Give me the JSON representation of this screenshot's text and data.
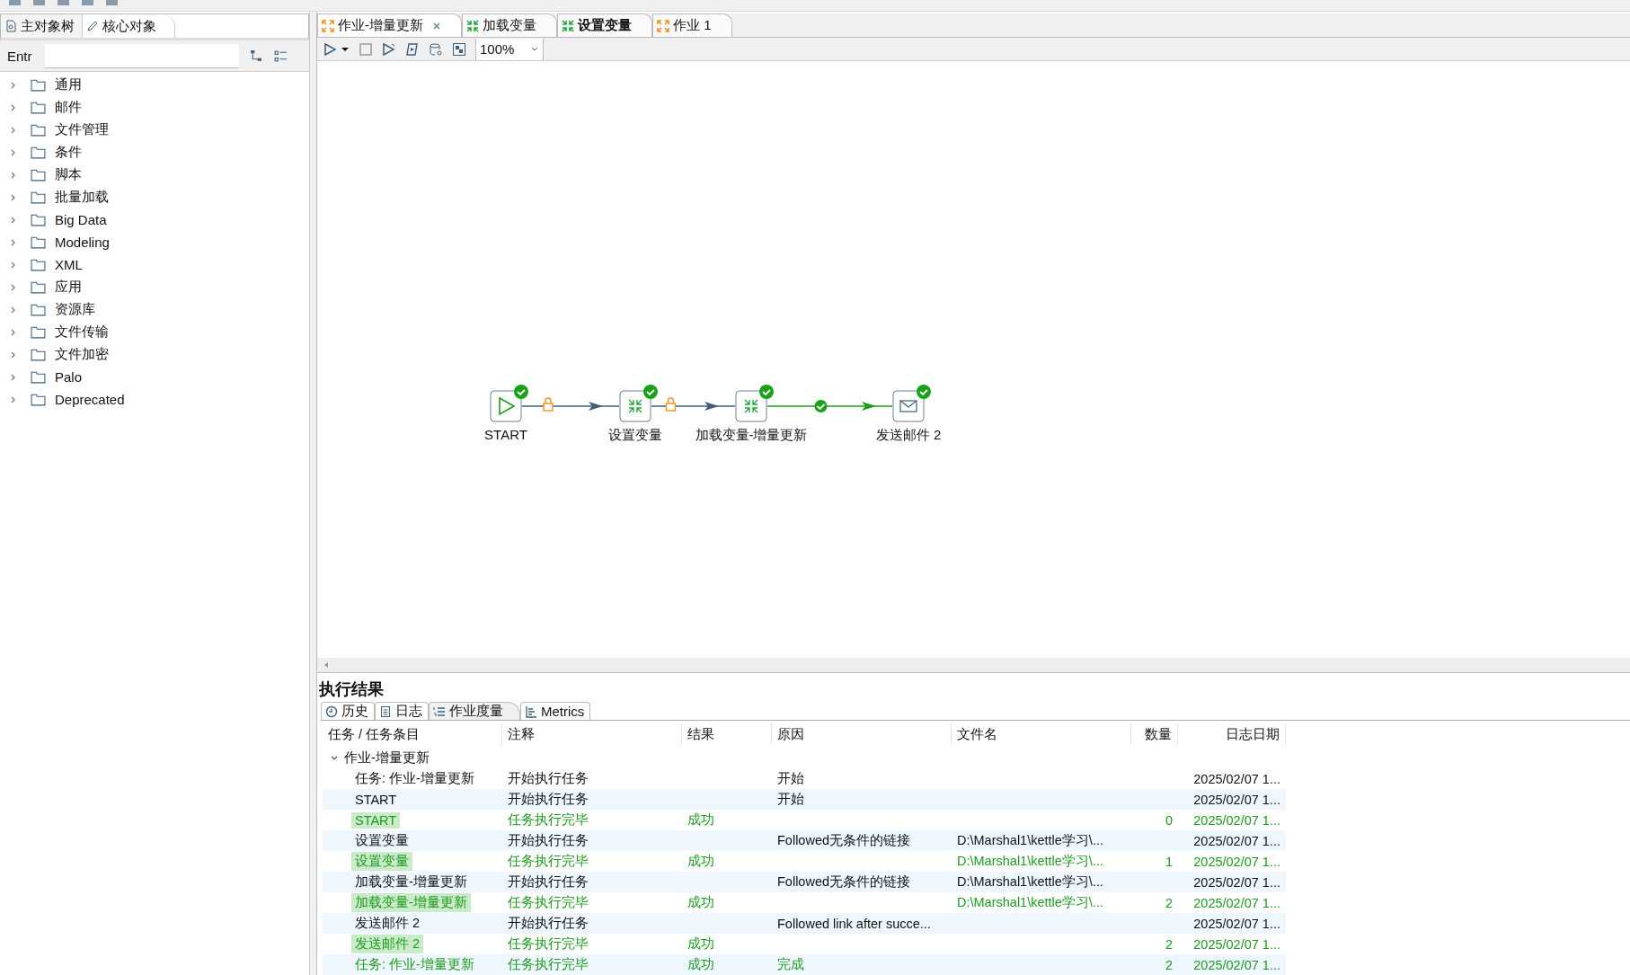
{
  "left_panel": {
    "tabs": [
      {
        "label": "主对象树",
        "kind": "tree",
        "selected": false
      },
      {
        "label": "核心对象",
        "kind": "pencil",
        "selected": true
      }
    ],
    "filter": {
      "label": "Entr"
    },
    "tree": [
      {
        "label": "通用",
        "expanded": false
      },
      {
        "label": "邮件",
        "expanded": false
      },
      {
        "label": "文件管理",
        "expanded": false
      },
      {
        "label": "条件",
        "expanded": false
      },
      {
        "label": "脚本",
        "expanded": false
      },
      {
        "label": "批量加载",
        "expanded": false
      },
      {
        "label": "Big Data",
        "expanded": false
      },
      {
        "label": "Modeling",
        "expanded": false
      },
      {
        "label": "XML",
        "expanded": false
      },
      {
        "label": "应用",
        "expanded": false
      },
      {
        "label": "资源库",
        "expanded": false
      },
      {
        "label": "文件传输",
        "expanded": false
      },
      {
        "label": "文件加密",
        "expanded": false
      },
      {
        "label": "Palo",
        "expanded": false
      },
      {
        "label": "Deprecated",
        "expanded": false
      }
    ]
  },
  "editor": {
    "tabs": [
      {
        "label": "作业-增量更新",
        "kind": "job",
        "selected": true,
        "emphasized": false
      },
      {
        "label": "加载变量",
        "kind": "transformation",
        "selected": false,
        "emphasized": false
      },
      {
        "label": "设置变量",
        "kind": "transformation",
        "selected": false,
        "emphasized": true
      },
      {
        "label": "作业 1",
        "kind": "job",
        "selected": false,
        "emphasized": false
      }
    ],
    "zoom": "100%",
    "nodes": [
      {
        "label": "START",
        "kind": "start",
        "succeeded": true
      },
      {
        "label": "设置变量",
        "kind": "transformation",
        "succeeded": true
      },
      {
        "label": "加载变量-增量更新",
        "kind": "transformation",
        "succeeded": true
      },
      {
        "label": "发送邮件 2",
        "kind": "mail",
        "succeeded": true
      }
    ],
    "hops": [
      {
        "kind": "unconditional"
      },
      {
        "kind": "unconditional"
      },
      {
        "kind": "success"
      }
    ]
  },
  "results": {
    "title": "执行结果",
    "tabs": [
      {
        "label": "历史",
        "kind": "history",
        "selected": false
      },
      {
        "label": "日志",
        "kind": "log",
        "selected": false
      },
      {
        "label": "作业度量",
        "kind": "list",
        "selected": true
      },
      {
        "label": "Metrics",
        "kind": "chart",
        "selected": false
      }
    ],
    "columns": [
      "任务 / 任务条目",
      "注释",
      "结果",
      "原因",
      "文件名",
      "数量",
      "日志日期"
    ],
    "root": {
      "label": "作业-增量更新",
      "expanded": true,
      "children": [
        {
          "task": "任务: 作业-增量更新",
          "comment": "开始执行任务",
          "reason": "开始",
          "date": "2025/02/07 1...",
          "finished": false,
          "highlight": false
        },
        {
          "task": "START",
          "comment": "开始执行任务",
          "reason": "开始",
          "date": "2025/02/07 1...",
          "finished": false,
          "highlight": false
        },
        {
          "task": "START",
          "comment": "任务执行完毕",
          "result": "成功",
          "count": "0",
          "date": "2025/02/07 1...",
          "finished": true,
          "highlight": true
        },
        {
          "task": "设置变量",
          "comment": "开始执行任务",
          "reason": "Followed无条件的链接",
          "filename": "D:\\Marshal1\\kettle学习\\...",
          "date": "2025/02/07 1...",
          "finished": false,
          "highlight": false
        },
        {
          "task": "设置变量",
          "comment": "任务执行完毕",
          "result": "成功",
          "filename": "D:\\Marshal1\\kettle学习\\...",
          "count": "1",
          "date": "2025/02/07 1...",
          "finished": true,
          "highlight": true
        },
        {
          "task": "加载变量-增量更新",
          "comment": "开始执行任务",
          "reason": "Followed无条件的链接",
          "filename": "D:\\Marshal1\\kettle学习\\...",
          "date": "2025/02/07 1...",
          "finished": false,
          "highlight": false
        },
        {
          "task": "加载变量-增量更新",
          "comment": "任务执行完毕",
          "result": "成功",
          "filename": "D:\\Marshal1\\kettle学习\\...",
          "count": "2",
          "date": "2025/02/07 1...",
          "finished": true,
          "highlight": true
        },
        {
          "task": "发送邮件 2",
          "comment": "开始执行任务",
          "reason": "Followed link after succe...",
          "date": "2025/02/07 1...",
          "finished": false,
          "highlight": false
        },
        {
          "task": "发送邮件 2",
          "comment": "任务执行完毕",
          "result": "成功",
          "count": "2",
          "date": "2025/02/07 1...",
          "finished": true,
          "highlight": true
        },
        {
          "task": "任务: 作业-增量更新",
          "comment": "任务执行完毕",
          "result": "成功",
          "reason": "完成",
          "count": "2",
          "date": "2025/02/07 1...",
          "finished": true,
          "highlight": false
        }
      ]
    }
  }
}
